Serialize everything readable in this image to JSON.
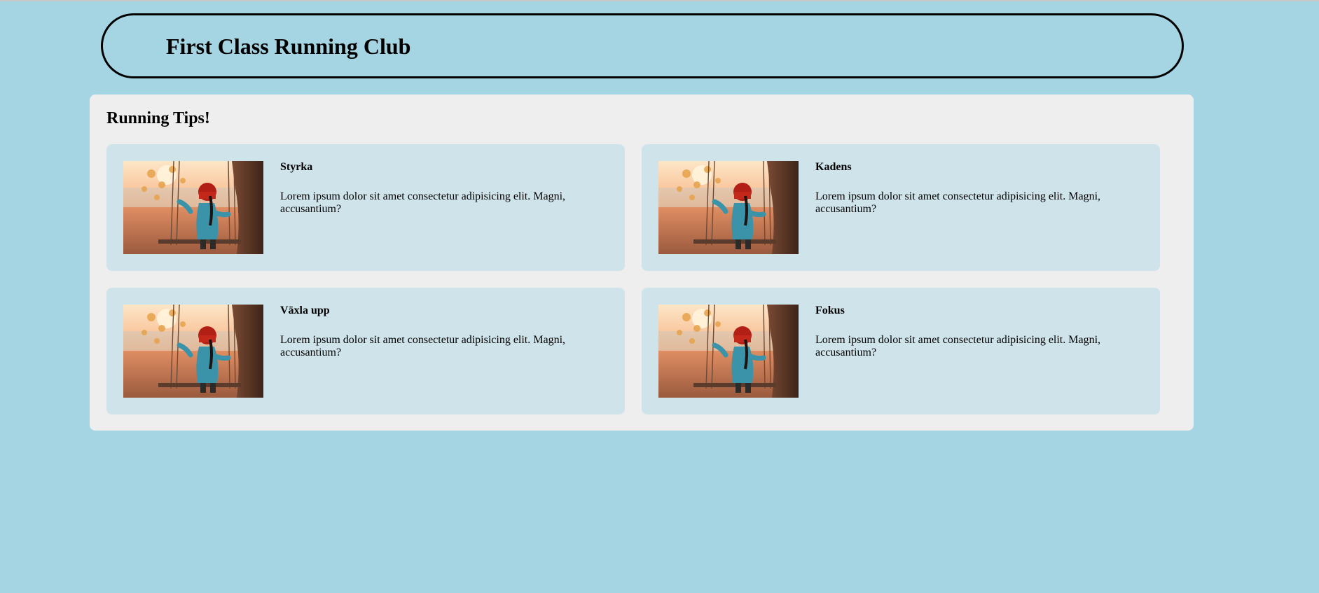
{
  "header": {
    "title": "First Class Running Club"
  },
  "main": {
    "heading": "Running Tips!",
    "cards": [
      {
        "title": "Styrka",
        "text": "Lorem ipsum dolor sit amet consectetur adipisicing elit. Magni, accusantium?",
        "image_icon": "woman-on-swing-photo"
      },
      {
        "title": "Kadens",
        "text": "Lorem ipsum dolor sit amet consectetur adipisicing elit. Magni, accusantium?",
        "image_icon": "woman-on-swing-photo"
      },
      {
        "title": "Växla upp",
        "text": "Lorem ipsum dolor sit amet consectetur adipisicing elit. Magni, accusantium?",
        "image_icon": "woman-on-swing-photo"
      },
      {
        "title": "Fokus",
        "text": "Lorem ipsum dolor sit amet consectetur adipisicing elit. Magni, accusantium?",
        "image_icon": "woman-on-swing-photo"
      }
    ]
  },
  "colors": {
    "page_background": "#a5d5e3",
    "panel_background": "#eeeeee",
    "card_background": "#cfe3ea",
    "header_border": "#000000"
  }
}
